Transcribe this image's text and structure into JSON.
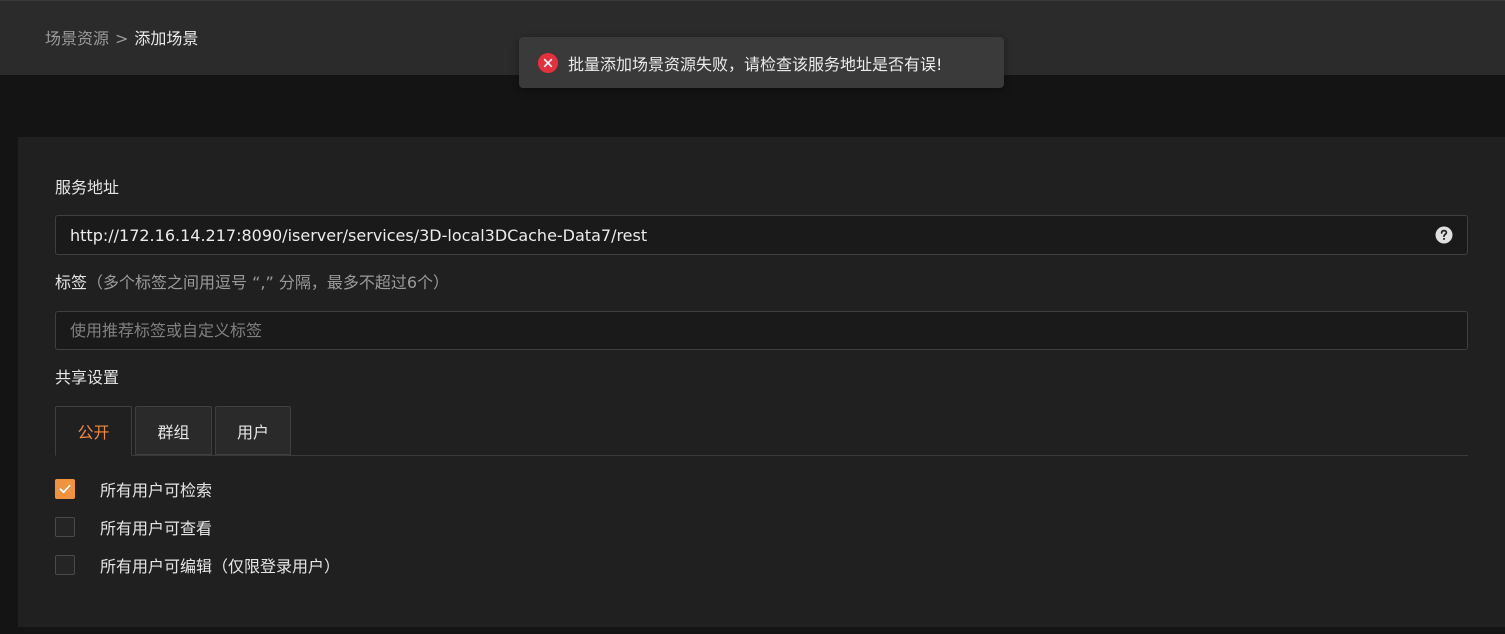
{
  "breadcrumb": {
    "parent": "场景资源",
    "separator": ">",
    "current": "添加场景"
  },
  "toast": {
    "type": "error",
    "message": "批量添加场景资源失败，请检查该服务地址是否有误!",
    "icon": "error-circle-icon"
  },
  "form": {
    "service_address": {
      "label": "服务地址",
      "value": "http://172.16.14.217:8090/iserver/services/3D-local3DCache-Data7/rest",
      "help_icon": "help-circle-icon"
    },
    "tags": {
      "label": "标签",
      "hint": "（多个标签之间用逗号 “,” 分隔，最多不超过6个）",
      "placeholder": "使用推荐标签或自定义标签",
      "value": ""
    },
    "sharing": {
      "label": "共享设置",
      "tabs": [
        {
          "label": "公开",
          "active": true
        },
        {
          "label": "群组",
          "active": false
        },
        {
          "label": "用户",
          "active": false
        }
      ],
      "options": [
        {
          "label": "所有用户可检索",
          "checked": true
        },
        {
          "label": "所有用户可查看",
          "checked": false
        },
        {
          "label": "所有用户可编辑（仅限登录用户）",
          "checked": false
        }
      ]
    }
  },
  "colors": {
    "accent": "#f08a3c",
    "error": "#e5303d",
    "background": "#141414",
    "panel": "#202020",
    "header": "#2b2b2b"
  }
}
